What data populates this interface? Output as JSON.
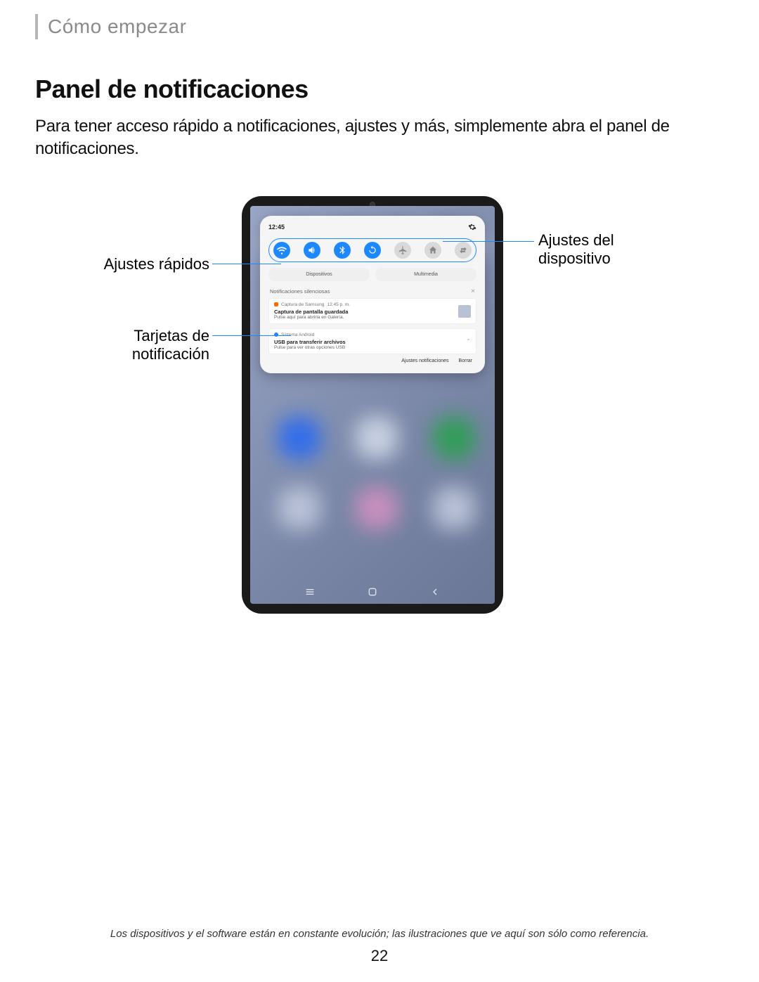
{
  "breadcrumb": "Cómo empezar",
  "title": "Panel de notificaciones",
  "intro": "Para tener acceso rápido a notificaciones, ajustes y más, simplemente abra el panel de notificaciones.",
  "callouts": {
    "quick_settings": "Ajustes rápidos",
    "notification_cards_l1": "Tarjetas de",
    "notification_cards_l2": "notificación",
    "device_settings_l1": "Ajustes del",
    "device_settings_l2": "dispositivo"
  },
  "shade": {
    "time": "12:45",
    "tabs": {
      "devices": "Dispositivos",
      "multimedia": "Multimedia"
    },
    "silent_header": "Notificaciones silenciosas",
    "card1": {
      "app": "Captura de Samsung",
      "time": "12:45 p. m.",
      "title": "Captura de pantalla guardada",
      "sub": "Pulse aquí para abrirla en Galería."
    },
    "card2": {
      "app": "Sistema Android",
      "title": "USB para transferir archivos",
      "sub": "Pulse para ver otras opciones USB"
    },
    "actions": {
      "settings": "Ajustes notificaciones",
      "clear": "Borrar"
    }
  },
  "qs_icons": [
    "wifi",
    "volume",
    "bluetooth",
    "rotate",
    "airplane",
    "home",
    "swap"
  ],
  "qs_state": [
    true,
    true,
    true,
    true,
    false,
    false,
    false
  ],
  "footnote": "Los dispositivos y el software están en constante evolución; las ilustraciones que ve aquí son sólo como referencia.",
  "page_number": "22"
}
